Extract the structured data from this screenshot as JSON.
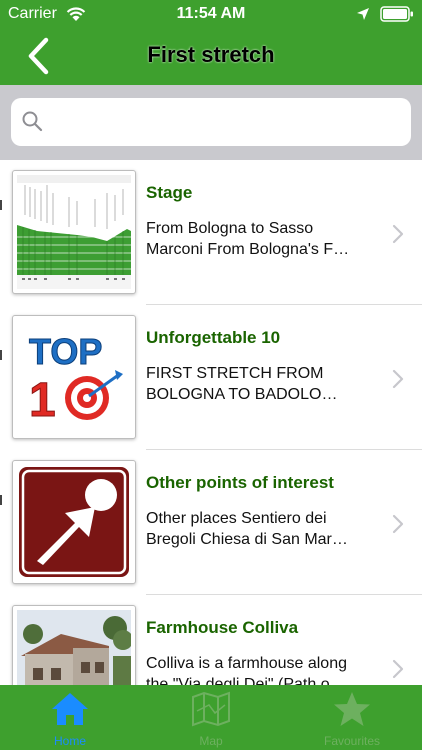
{
  "status_bar": {
    "carrier": "Carrier",
    "time": "11:54 AM"
  },
  "nav": {
    "title": "First stretch",
    "back_icon": "chevron-left-icon"
  },
  "search": {
    "placeholder": "",
    "value": "",
    "icon": "search-icon"
  },
  "rows": [
    {
      "title": "Stage",
      "line1": "From Bologna to Sasso",
      "line2": "Marconi From Bologna's F…",
      "thumb": "elevation-profile-chart"
    },
    {
      "title": "Unforgettable 10",
      "line1": "FIRST STRETCH FROM",
      "line2": "BOLOGNA TO BADOLO…",
      "thumb": "top-10-target-logo",
      "thumb_text_top": "TOP",
      "thumb_text_num": "10"
    },
    {
      "title": "Other points of interest",
      "line1": "Other places Sentiero dei",
      "line2": "Bregoli Chiesa di San Mar…",
      "thumb": "point-of-interest-sign"
    },
    {
      "title": "Farmhouse Colliva",
      "line1": "Colliva is a farmhouse along",
      "line2": "the \"Via degli Dei\" (Path o…",
      "thumb": "farmhouse-photo"
    }
  ],
  "tabs": [
    {
      "label": "Home",
      "icon": "home-icon",
      "selected": true
    },
    {
      "label": "Map",
      "icon": "map-icon",
      "selected": false
    },
    {
      "label": "Favourites",
      "icon": "star-icon",
      "selected": false
    }
  ],
  "colors": {
    "bar": "#3ea02e",
    "title_green": "#1a6400",
    "tab_selected": "#1a8cff",
    "tab_unselected": "#6db05f"
  }
}
